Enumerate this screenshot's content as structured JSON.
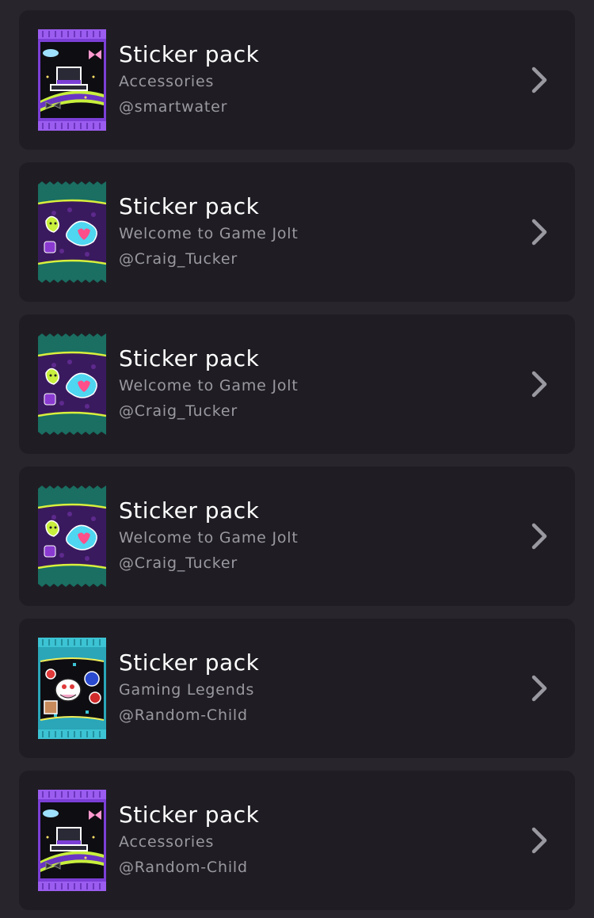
{
  "packs": [
    {
      "title": "Sticker pack",
      "subtitle": "Accessories",
      "owner": "@smartwater",
      "theme": "accessories",
      "accent": "#8e4ce6"
    },
    {
      "title": "Sticker pack",
      "subtitle": "Welcome to Game Jolt",
      "owner": "@Craig_Tucker",
      "theme": "welcome",
      "accent": "#1a6e62"
    },
    {
      "title": "Sticker pack",
      "subtitle": "Welcome to Game Jolt",
      "owner": "@Craig_Tucker",
      "theme": "welcome",
      "accent": "#1a6e62"
    },
    {
      "title": "Sticker pack",
      "subtitle": "Welcome to Game Jolt",
      "owner": "@Craig_Tucker",
      "theme": "welcome",
      "accent": "#1a6e62"
    },
    {
      "title": "Sticker pack",
      "subtitle": "Gaming Legends",
      "owner": "@Random-Child",
      "theme": "legends",
      "accent": "#2aa6b8"
    },
    {
      "title": "Sticker pack",
      "subtitle": "Accessories",
      "owner": "@Random-Child",
      "theme": "accessories",
      "accent": "#8e4ce6"
    }
  ],
  "icons": {
    "chevron": "chevron-right-icon"
  },
  "colors": {
    "background": "#28262c",
    "card": "#1f1d23",
    "title": "#ffffff",
    "secondary": "#9a98a0"
  }
}
